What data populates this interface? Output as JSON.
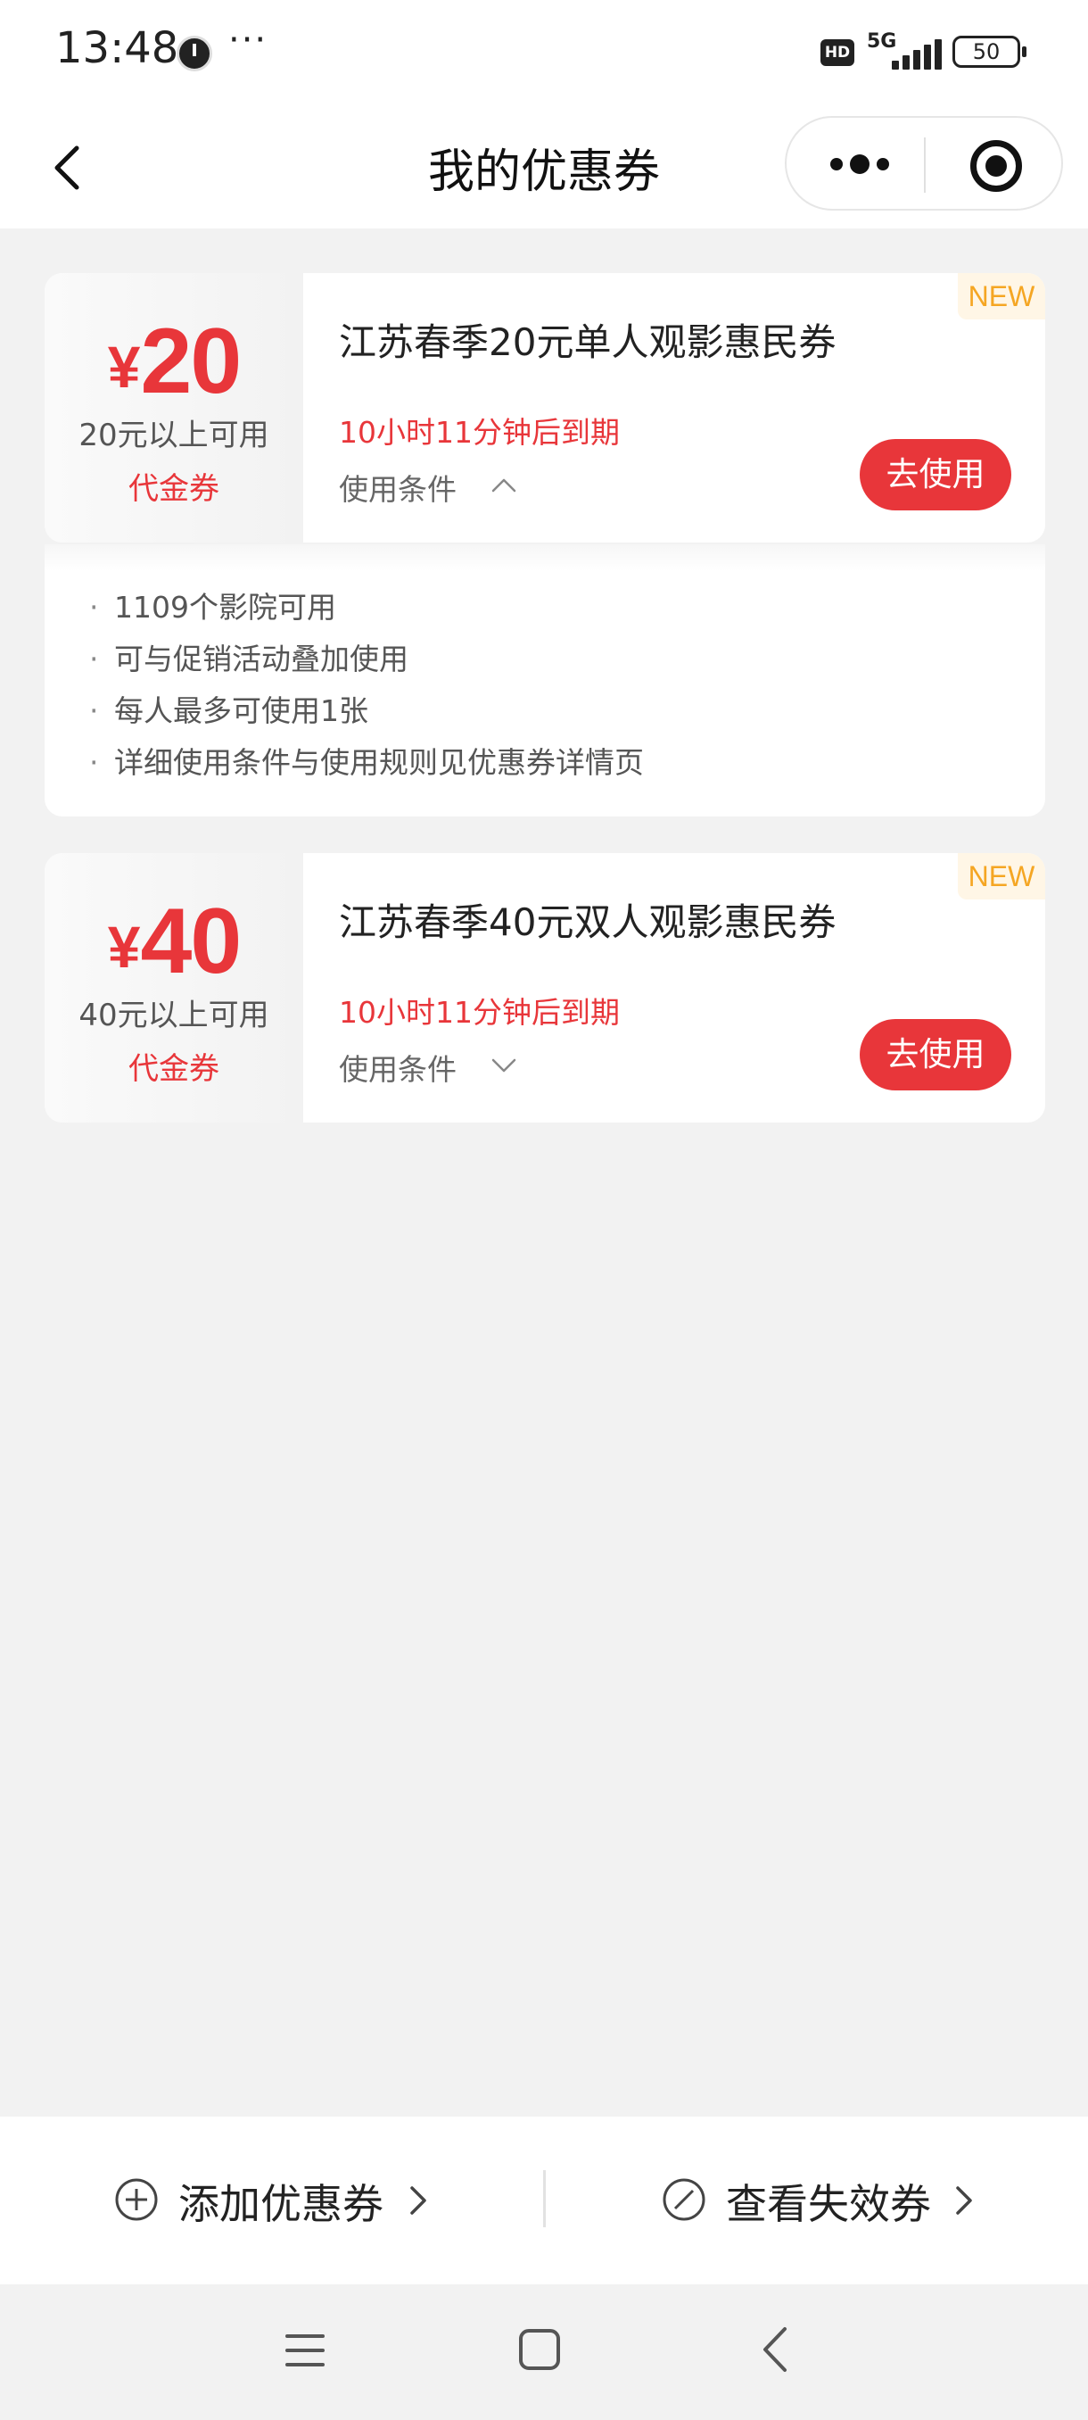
{
  "status_bar": {
    "time": "13:48",
    "more": "···",
    "hd": "HD",
    "network": "5G",
    "battery": "50"
  },
  "nav": {
    "title": "我的优惠券"
  },
  "coupons": [
    {
      "currency": "¥",
      "amount": "20",
      "min_spend": "20元以上可用",
      "kind": "代金券",
      "title": "江苏春季20元单人观影惠民券",
      "expire": "10小时11分钟后到期",
      "conditions_label": "使用条件",
      "conditions_expanded": true,
      "use_label": "去使用",
      "tag": "NEW",
      "conditions": [
        "1109个影院可用",
        "可与促销活动叠加使用",
        "每人最多可使用1张",
        "详细使用条件与使用规则见优惠券详情页"
      ]
    },
    {
      "currency": "¥",
      "amount": "40",
      "min_spend": "40元以上可用",
      "kind": "代金券",
      "title": "江苏春季40元双人观影惠民券",
      "expire": "10小时11分钟后到期",
      "conditions_label": "使用条件",
      "conditions_expanded": false,
      "use_label": "去使用",
      "tag": "NEW"
    }
  ],
  "bottom_bar": {
    "add_label": "添加优惠券",
    "expired_label": "查看失效券"
  },
  "colors": {
    "accent": "#e8363a",
    "new_tag": "#f5a623",
    "background": "#f2f2f2"
  }
}
